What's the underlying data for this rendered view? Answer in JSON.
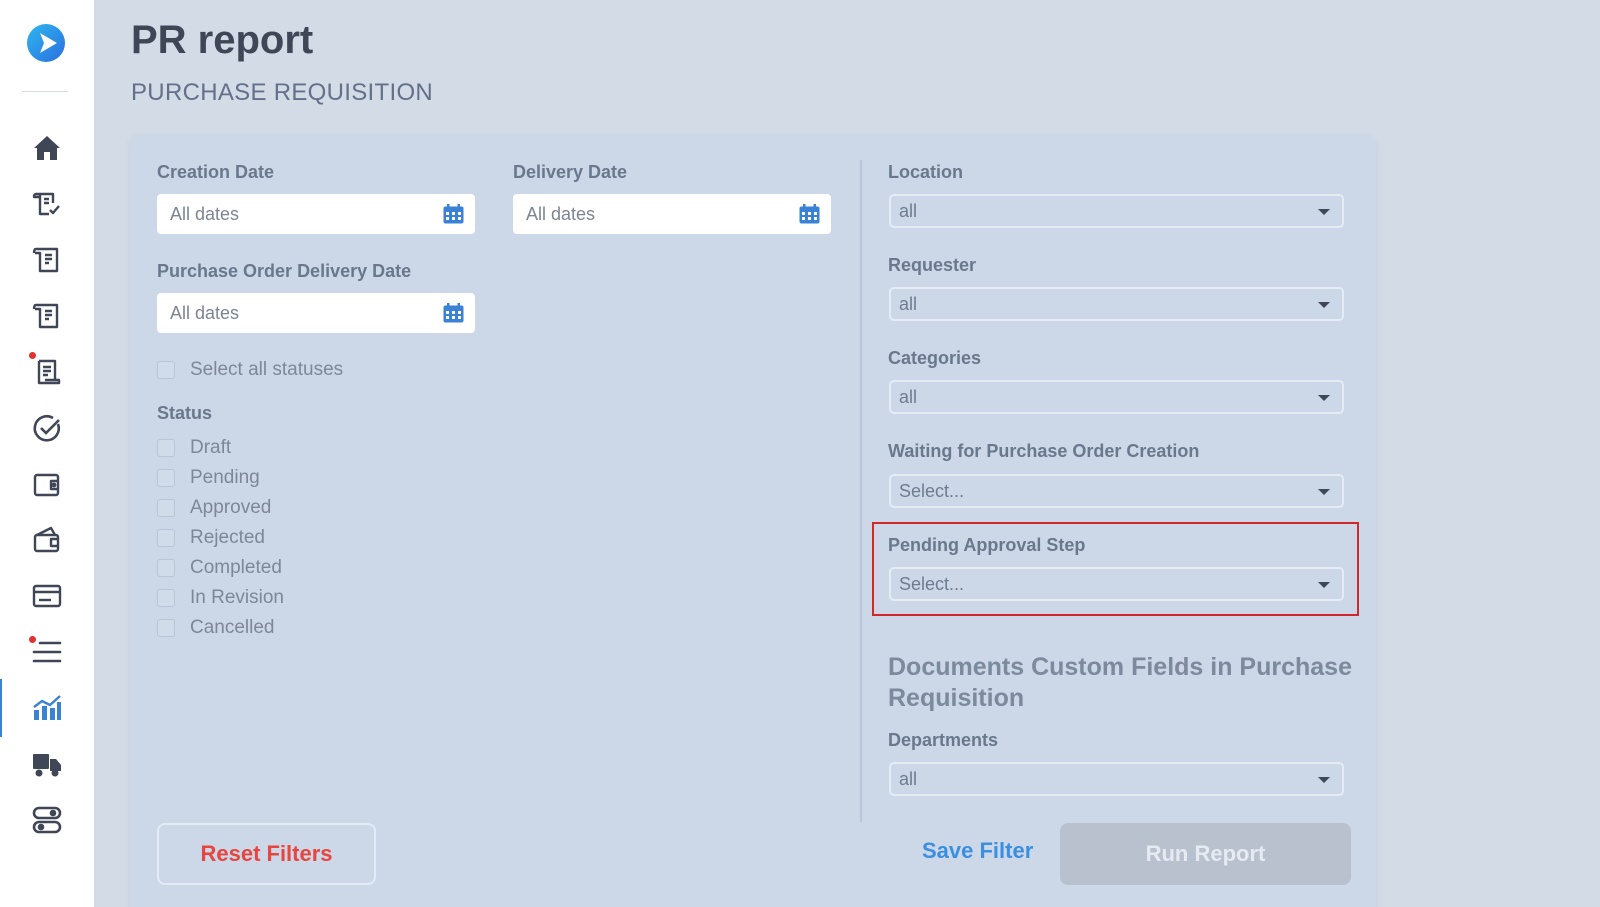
{
  "header": {
    "title": "PR report",
    "subtitle": "PURCHASE REQUISITION"
  },
  "sidebar": {
    "items": [
      {
        "icon": "home-icon"
      },
      {
        "icon": "document-check-icon"
      },
      {
        "icon": "document-icon"
      },
      {
        "icon": "document-icon"
      },
      {
        "icon": "document-notification-icon"
      },
      {
        "icon": "check-circle-icon"
      },
      {
        "icon": "wallet-icon"
      },
      {
        "icon": "wallet-icon"
      },
      {
        "icon": "card-icon"
      },
      {
        "icon": "list-icon"
      },
      {
        "icon": "chart-icon",
        "active": true
      },
      {
        "icon": "truck-icon"
      },
      {
        "icon": "toggle-icon"
      }
    ]
  },
  "filters": {
    "creation_date": {
      "label": "Creation Date",
      "value": "All dates"
    },
    "delivery_date": {
      "label": "Delivery Date",
      "value": "All dates"
    },
    "po_delivery_date": {
      "label": "Purchase Order Delivery Date",
      "value": "All dates"
    },
    "select_all_statuses": "Select all statuses",
    "status_label": "Status",
    "statuses": [
      "Draft",
      "Pending",
      "Approved",
      "Rejected",
      "Completed",
      "In Revision",
      "Cancelled"
    ],
    "location": {
      "label": "Location",
      "value": "all"
    },
    "requester": {
      "label": "Requester",
      "value": "all"
    },
    "categories": {
      "label": "Categories",
      "value": "all"
    },
    "waiting_po": {
      "label": "Waiting for Purchase Order Creation",
      "value": "Select..."
    },
    "pending_step": {
      "label": "Pending Approval Step",
      "value": "Select..."
    },
    "custom_fields_title": "Documents Custom Fields in Purchase Requisition",
    "departments": {
      "label": "Departments",
      "value": "all"
    }
  },
  "actions": {
    "reset": "Reset Filters",
    "save": "Save Filter",
    "run": "Run Report"
  },
  "colors": {
    "accent": "#3b82d6",
    "danger": "#e8453f",
    "highlight": "#d3282a"
  }
}
